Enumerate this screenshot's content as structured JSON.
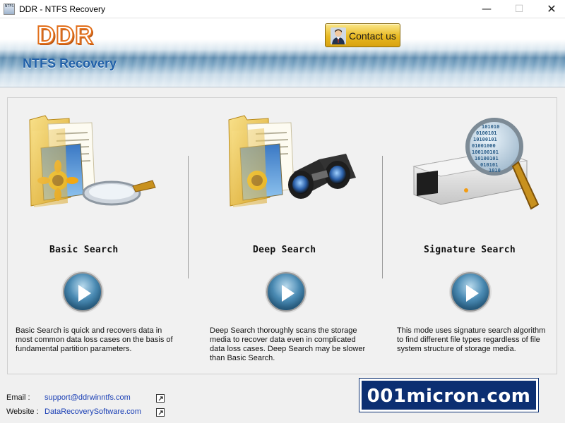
{
  "window": {
    "title": "DDR - NTFS Recovery",
    "app_icon_text": "NTFS",
    "minimize_glyph": "—",
    "maximize_glyph": "☐",
    "close_glyph": "✕"
  },
  "header": {
    "logo": "DDR",
    "subtitle": "NTFS Recovery",
    "contact_label": "Contact us",
    "contact_icon": "person-icon"
  },
  "modes": [
    {
      "title": "Basic Search",
      "description": "Basic Search is quick and recovers data in most common data loss cases on the basis of fundamental partition parameters.",
      "illustration": "folder-magnifier-icon"
    },
    {
      "title": "Deep Search",
      "description": "Deep Search thoroughly scans the storage media to recover data even in complicated data loss cases. Deep Search may be slower than Basic Search.",
      "illustration": "folder-binoculars-icon"
    },
    {
      "title": "Signature Search",
      "description": "This mode uses signature search algorithm to find different file types regardless of file system structure of storage media.",
      "illustration": "drive-binary-magnifier-icon"
    }
  ],
  "binary_text": [
    "101010",
    "0100101",
    "10100101",
    "01001000",
    "100100101",
    "10100101",
    "010101",
    "1010"
  ],
  "footer": {
    "email_label": "Email :",
    "email": "support@ddrwinntfs.com",
    "website_label": "Website :",
    "website": "DataRecoverySoftware.com"
  },
  "watermark": "001micron.com",
  "colors": {
    "logo_orange": "#e2701c",
    "subtitle_blue": "#1f5fa8",
    "contact_gold": "#e8b922",
    "link_blue": "#1a3fb5",
    "watermark_navy": "#0c2f72"
  }
}
